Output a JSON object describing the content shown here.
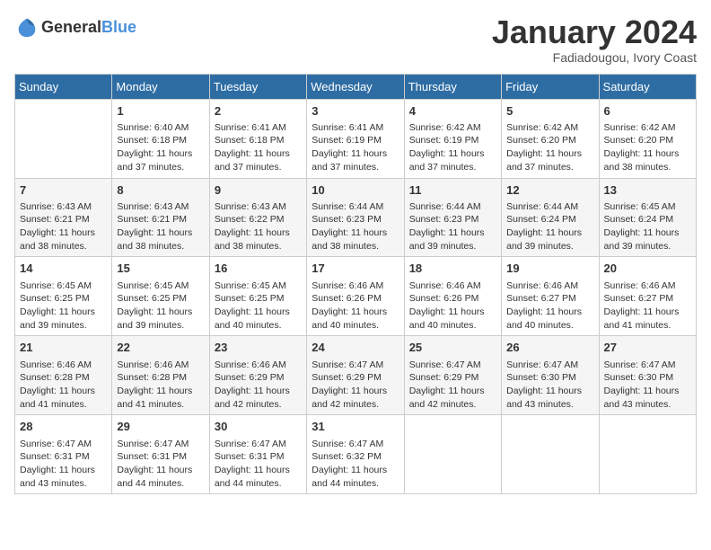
{
  "header": {
    "logo": {
      "general": "General",
      "blue": "Blue"
    },
    "title": "January 2024",
    "subtitle": "Fadiadougou, Ivory Coast"
  },
  "weekdays": [
    "Sunday",
    "Monday",
    "Tuesday",
    "Wednesday",
    "Thursday",
    "Friday",
    "Saturday"
  ],
  "weeks": [
    [
      {
        "day": null
      },
      {
        "day": 1,
        "sunrise": "6:40 AM",
        "sunset": "6:18 PM",
        "daylight": "11 hours and 37 minutes."
      },
      {
        "day": 2,
        "sunrise": "6:41 AM",
        "sunset": "6:18 PM",
        "daylight": "11 hours and 37 minutes."
      },
      {
        "day": 3,
        "sunrise": "6:41 AM",
        "sunset": "6:19 PM",
        "daylight": "11 hours and 37 minutes."
      },
      {
        "day": 4,
        "sunrise": "6:42 AM",
        "sunset": "6:19 PM",
        "daylight": "11 hours and 37 minutes."
      },
      {
        "day": 5,
        "sunrise": "6:42 AM",
        "sunset": "6:20 PM",
        "daylight": "11 hours and 37 minutes."
      },
      {
        "day": 6,
        "sunrise": "6:42 AM",
        "sunset": "6:20 PM",
        "daylight": "11 hours and 38 minutes."
      }
    ],
    [
      {
        "day": 7,
        "sunrise": "6:43 AM",
        "sunset": "6:21 PM",
        "daylight": "11 hours and 38 minutes."
      },
      {
        "day": 8,
        "sunrise": "6:43 AM",
        "sunset": "6:21 PM",
        "daylight": "11 hours and 38 minutes."
      },
      {
        "day": 9,
        "sunrise": "6:43 AM",
        "sunset": "6:22 PM",
        "daylight": "11 hours and 38 minutes."
      },
      {
        "day": 10,
        "sunrise": "6:44 AM",
        "sunset": "6:23 PM",
        "daylight": "11 hours and 38 minutes."
      },
      {
        "day": 11,
        "sunrise": "6:44 AM",
        "sunset": "6:23 PM",
        "daylight": "11 hours and 39 minutes."
      },
      {
        "day": 12,
        "sunrise": "6:44 AM",
        "sunset": "6:24 PM",
        "daylight": "11 hours and 39 minutes."
      },
      {
        "day": 13,
        "sunrise": "6:45 AM",
        "sunset": "6:24 PM",
        "daylight": "11 hours and 39 minutes."
      }
    ],
    [
      {
        "day": 14,
        "sunrise": "6:45 AM",
        "sunset": "6:25 PM",
        "daylight": "11 hours and 39 minutes."
      },
      {
        "day": 15,
        "sunrise": "6:45 AM",
        "sunset": "6:25 PM",
        "daylight": "11 hours and 39 minutes."
      },
      {
        "day": 16,
        "sunrise": "6:45 AM",
        "sunset": "6:25 PM",
        "daylight": "11 hours and 40 minutes."
      },
      {
        "day": 17,
        "sunrise": "6:46 AM",
        "sunset": "6:26 PM",
        "daylight": "11 hours and 40 minutes."
      },
      {
        "day": 18,
        "sunrise": "6:46 AM",
        "sunset": "6:26 PM",
        "daylight": "11 hours and 40 minutes."
      },
      {
        "day": 19,
        "sunrise": "6:46 AM",
        "sunset": "6:27 PM",
        "daylight": "11 hours and 40 minutes."
      },
      {
        "day": 20,
        "sunrise": "6:46 AM",
        "sunset": "6:27 PM",
        "daylight": "11 hours and 41 minutes."
      }
    ],
    [
      {
        "day": 21,
        "sunrise": "6:46 AM",
        "sunset": "6:28 PM",
        "daylight": "11 hours and 41 minutes."
      },
      {
        "day": 22,
        "sunrise": "6:46 AM",
        "sunset": "6:28 PM",
        "daylight": "11 hours and 41 minutes."
      },
      {
        "day": 23,
        "sunrise": "6:46 AM",
        "sunset": "6:29 PM",
        "daylight": "11 hours and 42 minutes."
      },
      {
        "day": 24,
        "sunrise": "6:47 AM",
        "sunset": "6:29 PM",
        "daylight": "11 hours and 42 minutes."
      },
      {
        "day": 25,
        "sunrise": "6:47 AM",
        "sunset": "6:29 PM",
        "daylight": "11 hours and 42 minutes."
      },
      {
        "day": 26,
        "sunrise": "6:47 AM",
        "sunset": "6:30 PM",
        "daylight": "11 hours and 43 minutes."
      },
      {
        "day": 27,
        "sunrise": "6:47 AM",
        "sunset": "6:30 PM",
        "daylight": "11 hours and 43 minutes."
      }
    ],
    [
      {
        "day": 28,
        "sunrise": "6:47 AM",
        "sunset": "6:31 PM",
        "daylight": "11 hours and 43 minutes."
      },
      {
        "day": 29,
        "sunrise": "6:47 AM",
        "sunset": "6:31 PM",
        "daylight": "11 hours and 44 minutes."
      },
      {
        "day": 30,
        "sunrise": "6:47 AM",
        "sunset": "6:31 PM",
        "daylight": "11 hours and 44 minutes."
      },
      {
        "day": 31,
        "sunrise": "6:47 AM",
        "sunset": "6:32 PM",
        "daylight": "11 hours and 44 minutes."
      },
      {
        "day": null
      },
      {
        "day": null
      },
      {
        "day": null
      }
    ]
  ]
}
